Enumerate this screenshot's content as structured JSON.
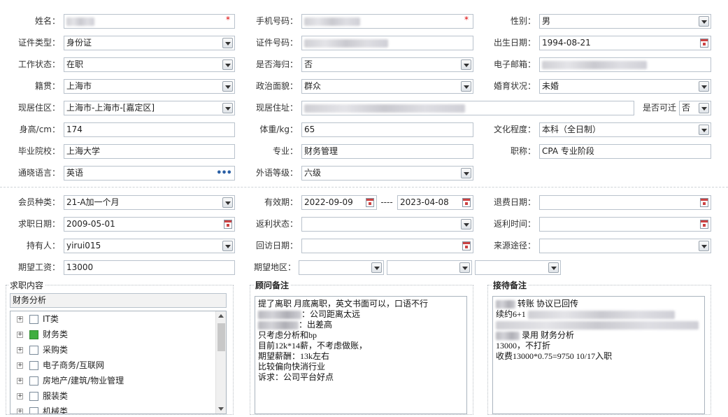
{
  "labels": {
    "name": "姓名：",
    "mobile": "手机号码：",
    "gender": "性别：",
    "id_type": "证件类型：",
    "id_no": "证件号码：",
    "birthdate": "出生日期：",
    "work_status": "工作状态：",
    "returnee": "是否海归：",
    "email": "电子邮箱：",
    "native_place": "籍贯：",
    "political": "政治面貌：",
    "marital": "婚育状况：",
    "current_area": "现居住区：",
    "current_address": "现居住址：",
    "relocate": "是否可迁",
    "height": "身高/cm：",
    "weight": "体重/kg：",
    "education": "文化程度：",
    "school": "毕业院校：",
    "major": "专业：",
    "title": "职称：",
    "languages": "通晓语言：",
    "lang_level": "外语等级：",
    "member_type": "会员种类：",
    "valid_period": "有效期：",
    "refund_date": "退费日期：",
    "job_date": "求职日期：",
    "rebate_status": "返利状态：",
    "rebate_time": "返利时间：",
    "holder": "持有人：",
    "visit_date": "回访日期：",
    "source": "来源途径：",
    "expected_salary": "期望工资：",
    "expected_region": "期望地区："
  },
  "values": {
    "gender": "男",
    "id_type": "身份证",
    "birthdate": "1994-08-21",
    "work_status": "在职",
    "returnee": "否",
    "native_place": "上海市",
    "political": "群众",
    "marital": "未婚",
    "current_area": "上海市-上海市-[嘉定区]",
    "relocate": "否",
    "height": "174",
    "weight": "65",
    "education": "本科（全日制）",
    "school": "上海大学",
    "major": "财务管理",
    "title": "CPA 专业阶段",
    "languages": "英语",
    "lang_level": "六级",
    "member_type": "21-A加一个月",
    "valid_from": "2022-09-09",
    "period_sep": "----",
    "valid_to": "2023-04-08",
    "job_date": "2009-05-01",
    "holder": "yirui015",
    "expected_salary": "13000"
  },
  "required_mark": "*",
  "ellipsis": "•••",
  "job_panel": {
    "title": "求职内容",
    "selected": "财务分析",
    "tree": [
      {
        "label": "IT类",
        "checked": false
      },
      {
        "label": "财务类",
        "checked": true
      },
      {
        "label": "采购类",
        "checked": false
      },
      {
        "label": "电子商务/互联网",
        "checked": false
      },
      {
        "label": "房地产/建筑/物业管理",
        "checked": false
      },
      {
        "label": "服装类",
        "checked": false
      },
      {
        "label": "机械类",
        "checked": false
      }
    ]
  },
  "advisor_notes": {
    "title": "顾问备注",
    "lines": [
      "提了离职 月底离职，英文书面可以，口语不行",
      "：公司距离太远",
      "：出差高",
      "只考虑分析和bp",
      "目前12k*14薪，不考虑做账，",
      "期望薪酬：13k左右",
      "比较偏向快消行业",
      "诉求：公司平台好点"
    ]
  },
  "reception_notes": {
    "title": "接待备注",
    "lines": [
      "转账 协议已回传",
      "续约6+1",
      "录用 财务分析",
      "13000，不打折",
      "收费13000*0.75=9750 10/17入职"
    ]
  },
  "colors": {
    "border": "#b9c2cc",
    "check_on": "#3fae3f",
    "required": "#dd0000"
  }
}
